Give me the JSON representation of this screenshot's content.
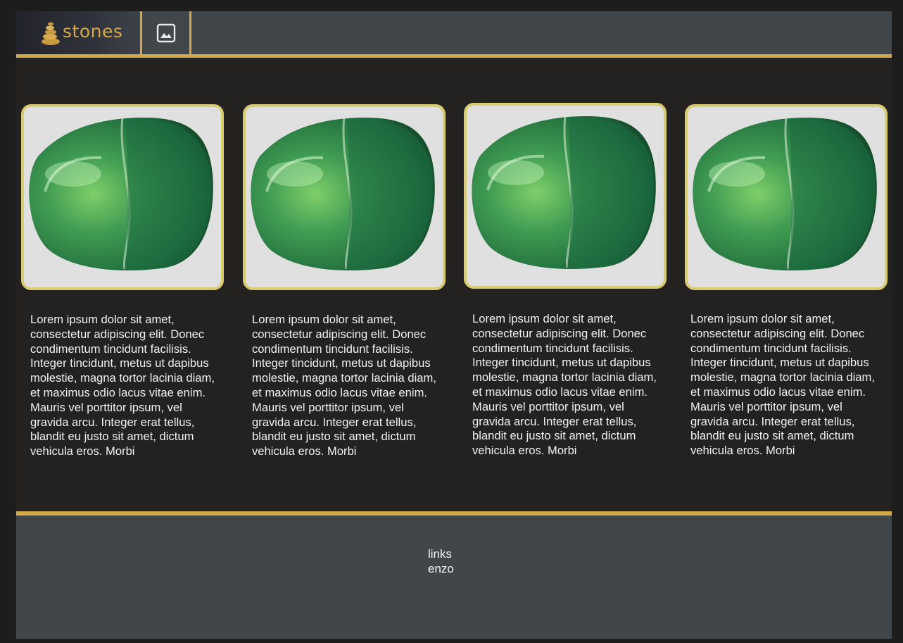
{
  "header": {
    "brand_name": "stones",
    "logo_icon": "stacked-stones-icon",
    "image_button_icon": "image-icon",
    "accent_color": "#d3a94a"
  },
  "cards": [
    {
      "image_alt": "green jade stone",
      "text": "Lorem ipsum dolor sit amet, consectetur adipiscing elit. Donec condimentum tincidunt facilisis. Integer tincidunt, metus ut dapibus molestie, magna tortor lacinia diam, et maximus odio lacus vitae enim. Mauris vel porttitor ipsum, vel gravida arcu. Integer erat tellus, blandit eu justo sit amet, dictum vehicula eros. Morbi"
    },
    {
      "image_alt": "green jade stone",
      "text": "Lorem ipsum dolor sit amet, consectetur adipiscing elit. Donec condimentum tincidunt facilisis. Integer tincidunt, metus ut dapibus molestie, magna tortor lacinia diam, et maximus odio lacus vitae enim. Mauris vel porttitor ipsum, vel gravida arcu. Integer erat tellus, blandit eu justo sit amet, dictum vehicula eros. Morbi"
    },
    {
      "image_alt": "green jade stone",
      "text": "Lorem ipsum dolor sit amet, consectetur adipiscing elit. Donec condimentum tincidunt facilisis. Integer tincidunt, metus ut dapibus molestie, magna tortor lacinia diam, et maximus odio lacus vitae enim. Mauris vel porttitor ipsum, vel gravida arcu. Integer erat tellus, blandit eu justo sit amet, dictum vehicula eros. Morbi"
    },
    {
      "image_alt": "green jade stone",
      "text": "Lorem ipsum dolor sit amet, consectetur adipiscing elit. Donec condimentum tincidunt facilisis. Integer tincidunt, metus ut dapibus molestie, magna tortor lacinia diam, et maximus odio lacus vitae enim. Mauris vel porttitor ipsum, vel gravida arcu. Integer erat tellus, blandit eu justo sit amet, dictum vehicula eros. Morbi"
    }
  ],
  "footer": {
    "links": [
      "links",
      "enzo"
    ]
  }
}
